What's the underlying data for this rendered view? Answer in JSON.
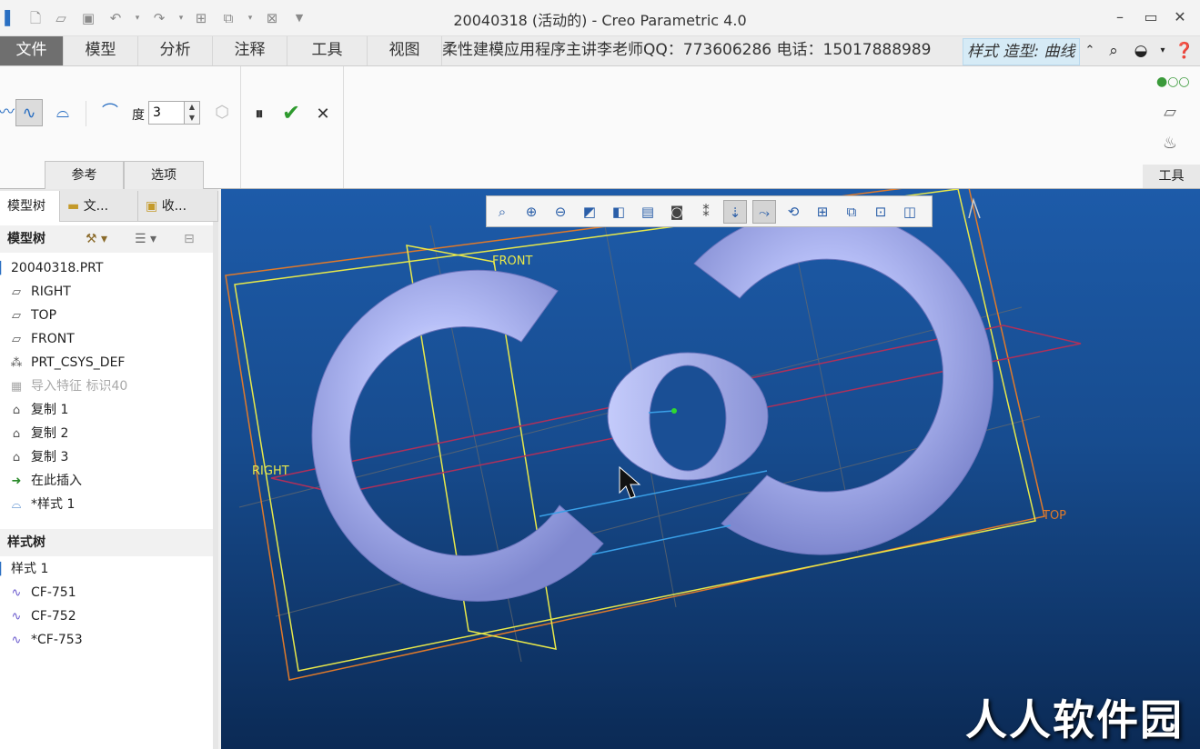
{
  "window": {
    "title": "20040318 (活动的) - Creo Parametric 4.0",
    "minimize": "–",
    "maximize": "▭",
    "close": "✕"
  },
  "ribbon_tabs": {
    "file": "文件",
    "model": "模型",
    "analysis": "分析",
    "annotate": "注释",
    "tools": "工具",
    "view": "视图",
    "banner": "柔性建模应用程序主讲李老师QQ：773606286 电话：15017888989",
    "style_tab": "样式 造型: 曲线"
  },
  "ribbon": {
    "degree_label": "度",
    "degree_value": "3",
    "references_tab": "参考",
    "options_tab": "选项",
    "tools_group": "工具"
  },
  "left_panel": {
    "tabs": [
      "模型树",
      "文...",
      "收..."
    ],
    "model_tree_header": "模型树",
    "model_tree": [
      {
        "label": "20040318.PRT",
        "icon": "part-icon",
        "dim": false
      },
      {
        "label": "RIGHT",
        "icon": "datum-plane-icon",
        "dim": false
      },
      {
        "label": "TOP",
        "icon": "datum-plane-icon",
        "dim": false
      },
      {
        "label": "FRONT",
        "icon": "datum-plane-icon",
        "dim": false
      },
      {
        "label": "PRT_CSYS_DEF",
        "icon": "csys-icon",
        "dim": false
      },
      {
        "label": "导入特征 标识40",
        "icon": "import-icon",
        "dim": true
      },
      {
        "label": "复制 1",
        "icon": "copy-icon",
        "dim": false
      },
      {
        "label": "复制 2",
        "icon": "copy-icon",
        "dim": false
      },
      {
        "label": "复制 3",
        "icon": "copy-icon",
        "dim": false
      },
      {
        "label": "在此插入",
        "icon": "insert-arrow-icon",
        "dim": false
      },
      {
        "label": "*样式 1",
        "icon": "style-icon",
        "dim": false
      }
    ],
    "style_tree_header": "样式树",
    "style_tree": [
      {
        "label": "样式 1"
      },
      {
        "label": "CF-751"
      },
      {
        "label": "CF-752"
      },
      {
        "label": "*CF-753"
      }
    ]
  },
  "viewport": {
    "labels": {
      "front": "FRONT",
      "right": "RIGHT",
      "top": "TOP"
    },
    "watermark": "人人软件园",
    "colors": {
      "surface": "#a9b3f2",
      "plane_yellow": "#e8e84a",
      "plane_orange": "#e07a2a",
      "plane_red": "#b0305a",
      "curve_blue": "#3aa0e8"
    }
  }
}
